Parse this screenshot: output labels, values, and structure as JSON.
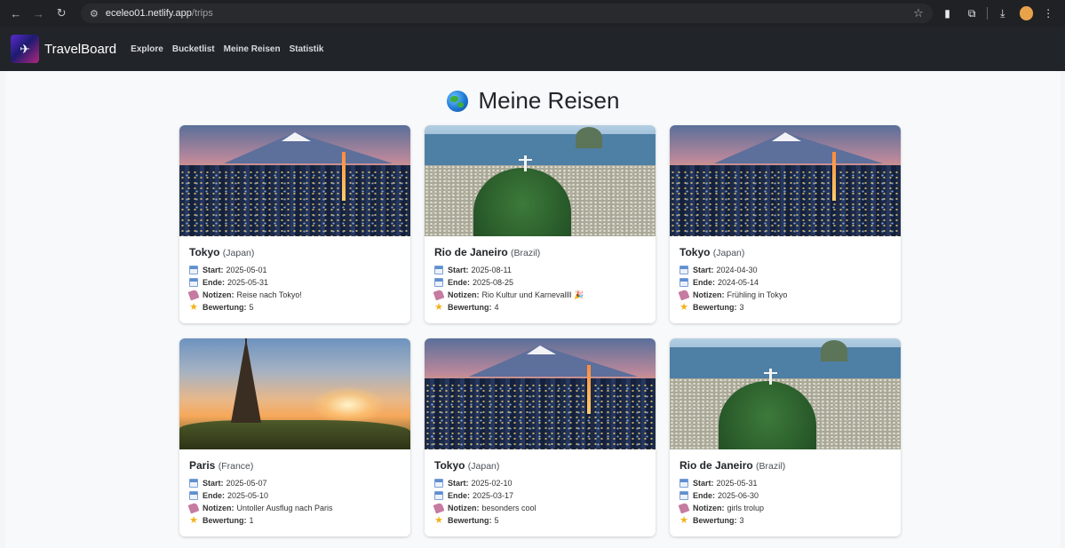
{
  "browser": {
    "url_host": "eceleo01.netlify.app",
    "url_path": "/trips"
  },
  "navbar": {
    "brand": "TravelBoard",
    "links": [
      "Explore",
      "Bucketlist",
      "Meine Reisen",
      "Statistik"
    ]
  },
  "page": {
    "title": "Meine Reisen"
  },
  "labels": {
    "start": "Start:",
    "end": "Ende:",
    "notes": "Notizen:",
    "rating": "Bewertung:"
  },
  "trips": [
    {
      "city": "Tokyo",
      "country": "(Japan)",
      "start": "2025-05-01",
      "end": "2025-05-31",
      "notes": "Reise nach Tokyo!",
      "rating": "5",
      "scene": "tokyo"
    },
    {
      "city": "Rio de Janeiro",
      "country": "(Brazil)",
      "start": "2025-08-11",
      "end": "2025-08-25",
      "notes": "Rio Kultur und Karnevallll 🎉",
      "rating": "4",
      "scene": "rio"
    },
    {
      "city": "Tokyo",
      "country": "(Japan)",
      "start": "2024-04-30",
      "end": "2024-05-14",
      "notes": "Frühling in Tokyo",
      "rating": "3",
      "scene": "tokyo"
    },
    {
      "city": "Paris",
      "country": "(France)",
      "start": "2025-05-07",
      "end": "2025-05-10",
      "notes": "Untoller Ausflug nach Paris",
      "rating": "1",
      "scene": "paris"
    },
    {
      "city": "Tokyo",
      "country": "(Japan)",
      "start": "2025-02-10",
      "end": "2025-03-17",
      "notes": "besonders cool",
      "rating": "5",
      "scene": "tokyo"
    },
    {
      "city": "Rio de Janeiro",
      "country": "(Brazil)",
      "start": "2025-05-31",
      "end": "2025-06-30",
      "notes": "girls trolup",
      "rating": "3",
      "scene": "rio"
    }
  ]
}
